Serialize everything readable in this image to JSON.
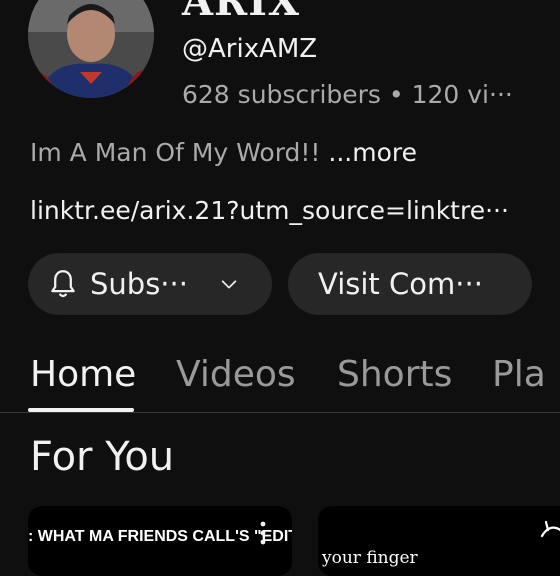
{
  "channel": {
    "name": "ARIX",
    "handle": "@ArixAMZ",
    "stats": "628 subscribers • 120 vi···",
    "description": "Im A Man Of My Word!!",
    "more_label": " ...more",
    "link": "linktr.ee/arix.21?utm_source=linktre···"
  },
  "buttons": {
    "subscribe_label": "Subs···",
    "community_label": "Visit Com···"
  },
  "tabs": [
    {
      "label": "Home",
      "active": true
    },
    {
      "label": "Videos",
      "active": false
    },
    {
      "label": "Shorts",
      "active": false
    },
    {
      "label": "Pla",
      "active": false
    }
  ],
  "section": {
    "title": "For You"
  },
  "videos": [
    {
      "caption": ": WHAT MA FRIENDS CALL'S \"EDIT"
    },
    {
      "caption": "your finger"
    }
  ],
  "icons": {
    "bell": "bell-icon",
    "chevron": "chevron-down-icon",
    "more": "more-vert-icon"
  },
  "colors": {
    "background": "#0f0f0f",
    "button_bg": "#272727",
    "text_primary": "#f1f1f1",
    "text_secondary": "#aaaaaa"
  }
}
